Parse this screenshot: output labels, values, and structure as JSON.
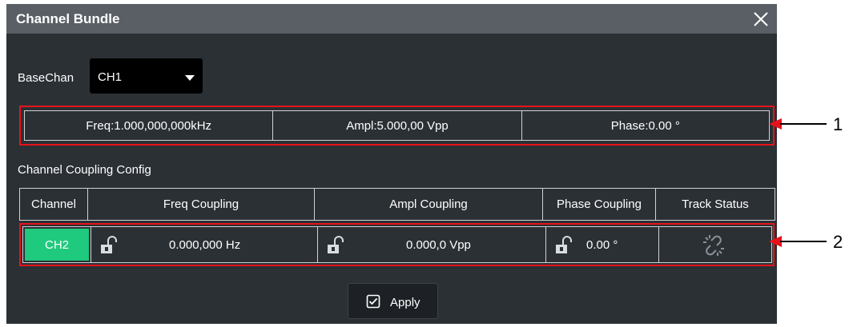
{
  "dialog": {
    "title": "Channel Bundle"
  },
  "base_channel": {
    "label": "BaseChan",
    "selected": "CH1"
  },
  "parameters": {
    "freq": "Freq:1.000,000,000kHz",
    "ampl": "Ampl:5.000,00 Vpp",
    "phase": "Phase:0.00 °"
  },
  "coupling": {
    "section_label": "Channel Coupling Config",
    "headers": [
      "Channel",
      "Freq Coupling",
      "Ampl Coupling",
      "Phase Coupling",
      "Track Status"
    ],
    "row": {
      "channel": "CH2",
      "freq_value": "0.000,000 Hz",
      "ampl_value": "0.000,0 Vpp",
      "phase_value": "0.00 °"
    }
  },
  "apply": {
    "label": "Apply"
  },
  "callouts": [
    "1",
    "2"
  ],
  "colors": {
    "dialog_bg": "#2b3035",
    "titlebar_bg": "#5a5f66",
    "highlight_border": "#e8121a",
    "channel_badge": "#1fca7e"
  },
  "icons": {
    "close": "close-icon",
    "dropdown": "triangle-down-icon",
    "lock": "unlock-icon",
    "track": "broken-link-icon",
    "apply": "checkbox-icon"
  }
}
